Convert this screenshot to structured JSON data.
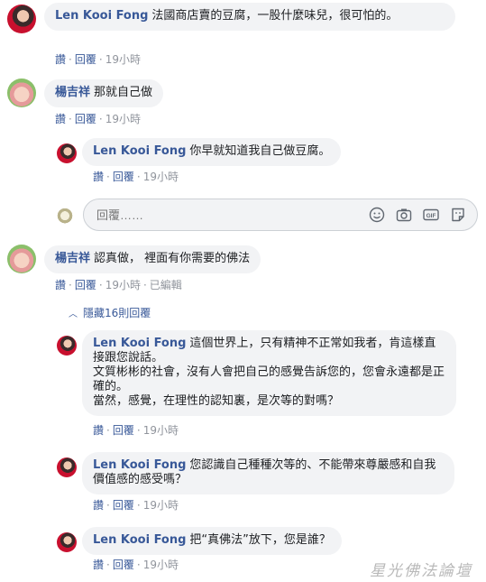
{
  "comments": [
    {
      "author": "Len Kooi Fong",
      "text": "法國商店賣的豆腐，一股什麼味兒，很可怕的。",
      "actions": {
        "like": "讚",
        "reply": "回覆",
        "time": "19小時"
      }
    },
    {
      "author": "楊吉祥",
      "text": "那就自己做",
      "actions": {
        "like": "讚",
        "reply": "回覆",
        "time": "19小時"
      }
    },
    {
      "author": "Len Kooi Fong",
      "text": "你早就知道我自己做豆腐。",
      "actions": {
        "like": "讚",
        "reply": "回覆",
        "time": "19小時"
      }
    },
    {
      "author": "楊吉祥",
      "text": "認真做， 裡面有你需要的佛法",
      "actions": {
        "like": "讚",
        "reply": "回覆",
        "time": "19小時",
        "edited": "已編輯"
      }
    },
    {
      "author": "Len Kooi Fong",
      "text": "這個世界上，只有精神不正常如我者，肯這樣直接跟您說話。\n文質彬彬的社會，沒有人會把自己的感覺告訴您的，您會永遠都是正確的。\n當然，感覺，在理性的認知裏，是次等的對嗎？",
      "actions": {
        "like": "讚",
        "reply": "回覆",
        "time": "19小時"
      }
    },
    {
      "author": "Len Kooi Fong",
      "text": "您認識自己種種次等的、不能帶來尊嚴感和自我價值感的感受嗎？",
      "actions": {
        "like": "讚",
        "reply": "回覆",
        "time": "19小時"
      }
    },
    {
      "author": "Len Kooi Fong",
      "text": "把“真佛法”放下，您是誰？",
      "actions": {
        "like": "讚",
        "reply": "回覆",
        "time": "19小時"
      }
    }
  ],
  "reply_box": {
    "placeholder": "回覆……"
  },
  "hide_replies": "隱藏16則回覆",
  "watermark": "星光佛法論壇",
  "icons": [
    "emoji-icon",
    "camera-icon",
    "gif-icon",
    "sticker-icon"
  ],
  "colors": {
    "name": "#385898",
    "bubble": "#f2f3f5",
    "meta": "#90949c"
  }
}
